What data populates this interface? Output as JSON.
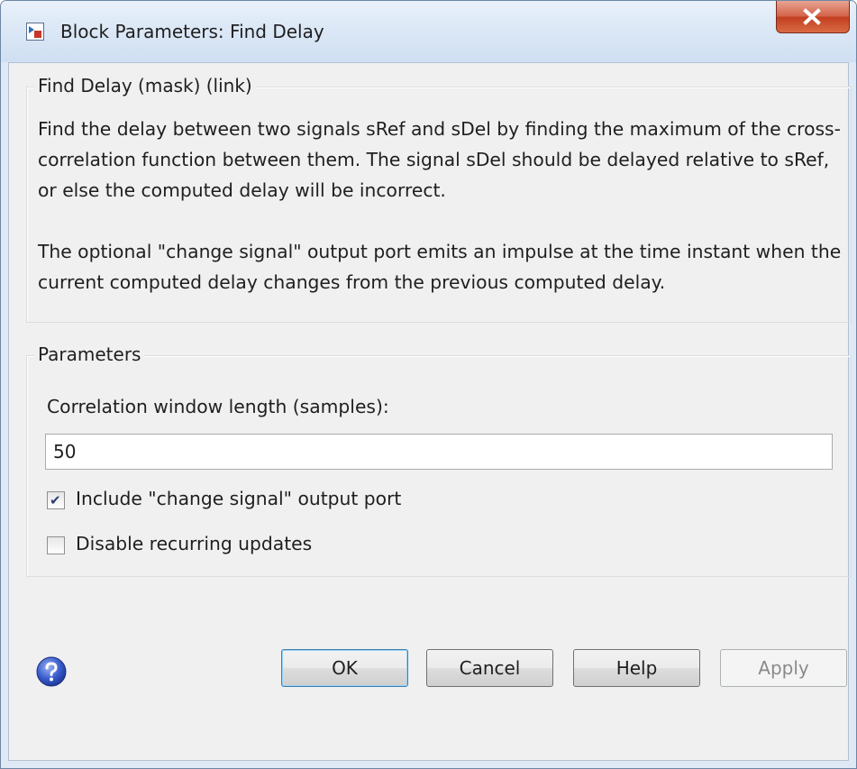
{
  "window": {
    "title": "Block Parameters: Find Delay"
  },
  "description_group": {
    "title": "Find Delay (mask) (link)",
    "paragraphs": [
      "Find the delay between two signals sRef and sDel by finding the maximum of the cross-correlation function between them.  The signal sDel should be delayed relative to sRef, or else the computed delay will be incorrect.",
      "The optional \"change signal\" output port emits an impulse at the time instant when the current computed delay changes from the previous computed delay."
    ]
  },
  "parameters_group": {
    "title": "Parameters",
    "window_length_label": "Correlation window length (samples):",
    "window_length_value": "50",
    "include_change_signal": {
      "label": "Include \"change signal\" output port",
      "checked": true
    },
    "disable_recurring_updates": {
      "label": "Disable recurring updates",
      "checked": false
    }
  },
  "buttons": {
    "ok": "OK",
    "cancel": "Cancel",
    "help": "Help",
    "apply": "Apply"
  },
  "icons": {
    "app": "simulink-block-icon",
    "close": "close-icon",
    "help": "question-mark-icon"
  },
  "colors": {
    "titlebar": "#dce8f6",
    "close_button": "#c9482a",
    "dialog_background": "#f0f0f0",
    "default_button_border": "#3c7fb1"
  }
}
